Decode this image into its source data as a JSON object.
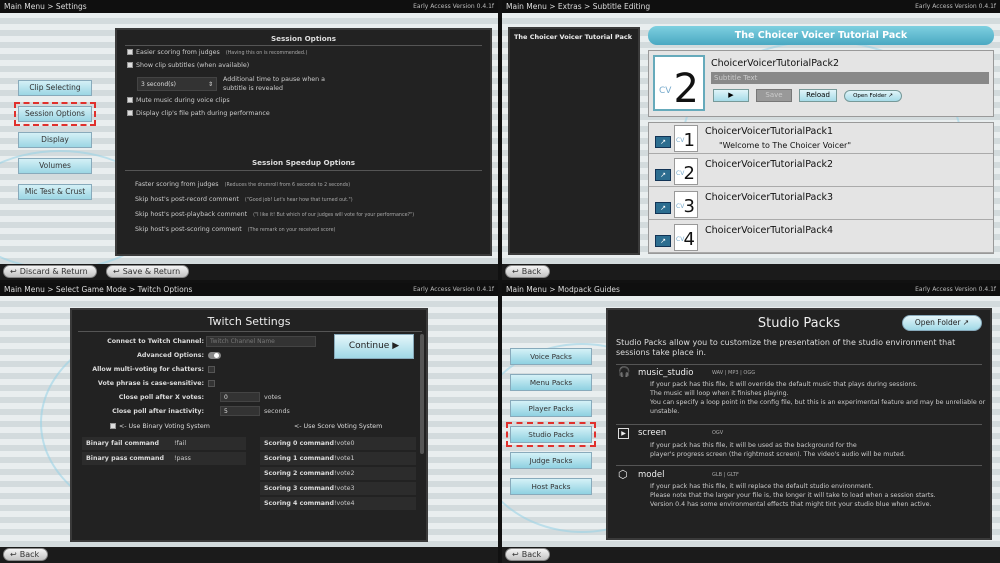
{
  "version": "Early Access Version 0.4.1f",
  "settings": {
    "breadcrumb": "Main Menu > Settings",
    "menu": [
      "Clip Selecting",
      "Session Options",
      "Display",
      "Volumes",
      "Mic Test & Crust"
    ],
    "session_options_title": "Session Options",
    "opt1": "Easier scoring from judges",
    "opt1_note": "(Having this on is recommended.)",
    "opt2": "Show clip subtitles (when available)",
    "pause_value": "3 second(s)",
    "pause_desc": "Additional time to pause when a subtitle is revealed",
    "opt3": "Mute music during voice clips",
    "opt4": "Display clip's file path during performance",
    "speedup_title": "Session Speedup Options",
    "speedups": [
      {
        "label": "Faster scoring from judges",
        "note": "(Reduces the drumroll from 6 seconds to 2 seconds)"
      },
      {
        "label": "Skip host's post-record comment",
        "note": "(\"Good job! Let's hear how that turned out.\")"
      },
      {
        "label": "Skip host's post-playback comment",
        "note": "(\"I like it! But which of our judges will vote for your performance?\")"
      },
      {
        "label": "Skip host's post-scoring comment",
        "note": "(The remark on your received score)"
      }
    ],
    "discard": "Discard & Return",
    "save": "Save & Return"
  },
  "subtitle": {
    "breadcrumb": "Main Menu > Extras > Subtitle Editing",
    "left_item": "The Choicer Voicer Tutorial Pack",
    "header": "The Choicer Voicer Tutorial Pack",
    "cv": "CV",
    "current_num": "2",
    "current_name": "ChoicerVoicerTutorialPack2",
    "placeholder": "Subtitle Text",
    "play": "▶",
    "save": "Save",
    "reload": "Reload",
    "open_folder": "Open Folder ↗",
    "items": [
      {
        "num": "1",
        "name": "ChoicerVoicerTutorialPack1",
        "sub": "\"Welcome to The Choicer Voicer\""
      },
      {
        "num": "2",
        "name": "ChoicerVoicerTutorialPack2",
        "sub": ""
      },
      {
        "num": "3",
        "name": "ChoicerVoicerTutorialPack3",
        "sub": ""
      },
      {
        "num": "4",
        "name": "ChoicerVoicerTutorialPack4",
        "sub": ""
      }
    ],
    "back": "Back"
  },
  "twitch": {
    "breadcrumb": "Main Menu > Select Game Mode > Twitch Options",
    "title": "Twitch Settings",
    "connect_label": "Connect to Twitch Channel:",
    "channel_placeholder": "Twitch Channel Name",
    "continue": "Continue ▶",
    "advanced": "Advanced Options:",
    "multi": "Allow multi-voting for chatters:",
    "case": "Vote phrase is case-sensitive:",
    "close_votes_label": "Close poll after X votes:",
    "close_votes_value": "0",
    "votes_unit": "votes",
    "inactivity_label": "Close poll after inactivity:",
    "inactivity_value": "5",
    "seconds_unit": "seconds",
    "binary": "<- Use Binary Voting System",
    "score": "<- Use Score Voting System",
    "binary_cmds": [
      {
        "label": "Binary fail command",
        "value": "!fail"
      },
      {
        "label": "Binary pass command",
        "value": "!pass"
      }
    ],
    "score_cmds": [
      {
        "label": "Scoring 0 command",
        "value": "!vote0"
      },
      {
        "label": "Scoring 1 command",
        "value": "!vote1"
      },
      {
        "label": "Scoring 2 command",
        "value": "!vote2"
      },
      {
        "label": "Scoring 3 command",
        "value": "!vote3"
      },
      {
        "label": "Scoring 4 command",
        "value": "!vote4"
      }
    ],
    "back": "Back"
  },
  "modpack": {
    "breadcrumb": "Main Menu > Modpack Guides",
    "menu": [
      "Voice Packs",
      "Menu Packs",
      "Player Packs",
      "Studio Packs",
      "Judge Packs",
      "Host Packs"
    ],
    "title": "Studio Packs",
    "open_folder": "Open Folder ↗",
    "intro": "Studio Packs allow you to customize the presentation of the studio environment that sessions take place in.",
    "files": [
      {
        "icon": "headphones-icon",
        "glyph": "🎧",
        "name": "music_studio",
        "formats": "WAV | MP3 | OGG",
        "desc": "If your pack has this file, it will override the default music that plays during sessions.\nThe music will loop when it finishes playing.\nYou can specify a loop point in the config file, but this is an experimental feature and may be unreliable or unstable."
      },
      {
        "icon": "video-play-icon",
        "glyph": "▶",
        "name": "screen",
        "formats": "OGV",
        "desc": "If your pack has this file, it will be used as the background for the\nplayer's progress screen (the rightmost screen). The video's audio will be muted."
      },
      {
        "icon": "cube-icon",
        "glyph": "⬡",
        "name": "model",
        "formats": "GLB | GLTF",
        "desc": "If your pack has this file, it will replace the default studio environment.\nPlease note that the larger your file is, the longer it will take to load when a session starts.\nVersion 0.4 has some environmental effects that might tint your studio blue when active."
      }
    ],
    "back": "Back"
  }
}
